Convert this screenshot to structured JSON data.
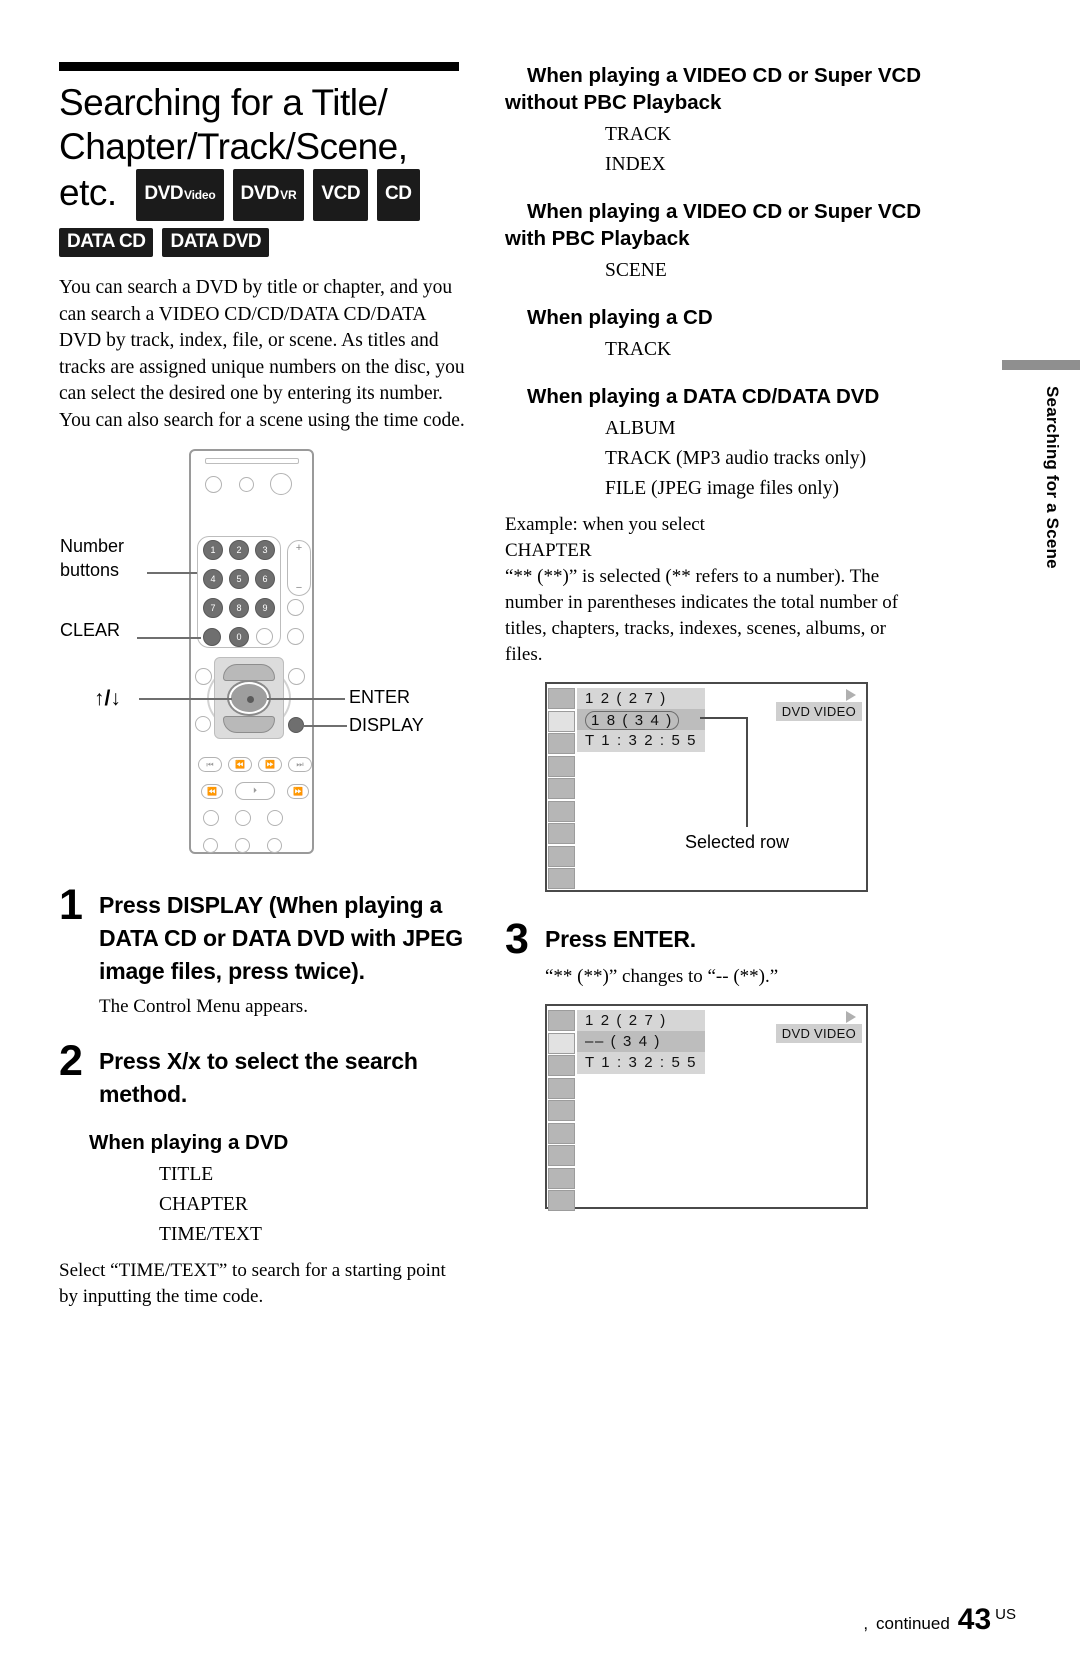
{
  "title": {
    "heading": "Searching for a Title/Chapter/Track/Scene, etc.",
    "badges": [
      {
        "big": "DVD",
        "small": "Video"
      },
      {
        "big": "DVD",
        "small": "VR"
      },
      {
        "big": "VCD",
        "small": ""
      },
      {
        "big": "CD",
        "small": ""
      },
      {
        "big": "DATA CD",
        "small": ""
      },
      {
        "big": "DATA DVD",
        "small": ""
      }
    ]
  },
  "intro": "You can search a DVD by title or chapter, and you can search a VIDEO CD/CD/DATA CD/DATA DVD by track, index, file, or scene. As titles and tracks are assigned unique numbers on the disc, you can select the desired one by entering its number. You can also search for a scene using the time code.",
  "remote": {
    "labels": {
      "number_buttons_line1": "Number",
      "number_buttons_line2": "buttons",
      "clear": "CLEAR",
      "updown": "↑/↓",
      "enter": "ENTER",
      "display": "DISPLAY"
    },
    "keys": [
      "1",
      "2",
      "3",
      "4",
      "5",
      "6",
      "7",
      "8",
      "9",
      "0"
    ],
    "volume_plus": "+",
    "volume_minus": "−"
  },
  "steps": [
    {
      "num": "1",
      "text": "Press DISPLAY (When playing a DATA CD or DATA DVD with JPEG image files, press twice).",
      "sub": "The Control Menu appears."
    },
    {
      "num": "2",
      "text": "Press X/x  to select the search method.",
      "sub": ""
    },
    {
      "num": "3",
      "text": "Press ENTER.",
      "sub": "“** (**)” changes to “-- (**).”"
    }
  ],
  "sections": [
    {
      "heading": "When playing a DVD",
      "items": [
        "TITLE",
        "CHAPTER",
        "TIME/TEXT"
      ]
    },
    {
      "heading": "When playing a VIDEO CD or Super VCD without PBC Playback",
      "items": [
        "TRACK",
        "INDEX"
      ]
    },
    {
      "heading": "When playing a VIDEO CD or Super VCD with PBC Playback",
      "items": [
        "SCENE"
      ]
    },
    {
      "heading": "When playing a CD",
      "items": [
        "TRACK"
      ]
    },
    {
      "heading": "When playing a DATA CD/DATA DVD",
      "items": [
        "ALBUM",
        "TRACK (MP3 audio tracks only)",
        "FILE (JPEG image files only)"
      ]
    }
  ],
  "time_text_note": "Select “TIME/TEXT” to search for a starting point by inputting the time code.",
  "example": {
    "line1": "Example: when you select",
    "line2": "CHAPTER",
    "body": "“** (**)” is selected (** refers to a number). The number in parentheses indicates the total number of titles, chapters, tracks, indexes, scenes, albums, or files."
  },
  "screen1": {
    "row1": "1 2 ( 2 7 )",
    "row2": "1 8 ( 3 4 )",
    "row3": "T      1 : 3 2 : 5 5",
    "disc_badge": "DVD VIDEO",
    "callout": "Selected row"
  },
  "screen2": {
    "row1": "1 2 ( 2 7 )",
    "row2": "–– ( 3 4 )",
    "row3": "T      1 : 3 2 : 5 5",
    "disc_badge": "DVD VIDEO"
  },
  "side_tab": "Searching for a Scene",
  "footer": {
    "cont_mark": ",",
    "continued": "continued",
    "page": "43",
    "region": "US"
  }
}
